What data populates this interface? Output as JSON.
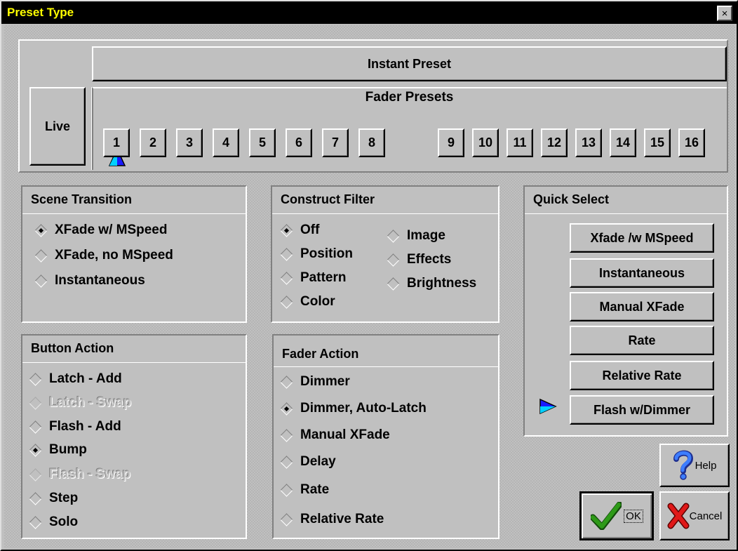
{
  "window": {
    "title": "Preset Type",
    "close": "×"
  },
  "top": {
    "instant_preset": "Instant Preset",
    "live": "Live",
    "fader_presets_label": "Fader Presets",
    "presets": [
      "1",
      "2",
      "3",
      "4",
      "5",
      "6",
      "7",
      "8",
      "9",
      "10",
      "11",
      "12",
      "13",
      "14",
      "15",
      "16"
    ],
    "selected_preset": "1"
  },
  "scene_transition": {
    "title": "Scene Transition",
    "options": [
      {
        "label": "XFade w/ MSpeed",
        "selected": true
      },
      {
        "label": "XFade, no MSpeed",
        "selected": false
      },
      {
        "label": "Instantaneous",
        "selected": false
      }
    ]
  },
  "construct_filter": {
    "title": "Construct Filter",
    "options": [
      {
        "label": "Off",
        "selected": true
      },
      {
        "label": "Position",
        "selected": false
      },
      {
        "label": "Pattern",
        "selected": false
      },
      {
        "label": "Color",
        "selected": false
      },
      {
        "label": "Image",
        "selected": false
      },
      {
        "label": "Effects",
        "selected": false
      },
      {
        "label": "Brightness",
        "selected": false
      }
    ]
  },
  "button_action": {
    "title": "Button Action",
    "options": [
      {
        "label": "Latch - Add",
        "selected": false,
        "disabled": false
      },
      {
        "label": "Latch - Swap",
        "selected": false,
        "disabled": true
      },
      {
        "label": "Flash - Add",
        "selected": false,
        "disabled": false
      },
      {
        "label": "Bump",
        "selected": true,
        "disabled": false
      },
      {
        "label": "Flash - Swap",
        "selected": false,
        "disabled": true
      },
      {
        "label": "Step",
        "selected": false,
        "disabled": false
      },
      {
        "label": "Solo",
        "selected": false,
        "disabled": false
      }
    ]
  },
  "fader_action": {
    "title": "Fader Action",
    "options": [
      {
        "label": "Dimmer",
        "selected": false
      },
      {
        "label": "Dimmer, Auto-Latch",
        "selected": true
      },
      {
        "label": "Manual XFade",
        "selected": false
      },
      {
        "label": "Delay",
        "selected": false
      },
      {
        "label": "Rate",
        "selected": false
      },
      {
        "label": "Relative Rate",
        "selected": false
      }
    ]
  },
  "quick_select": {
    "title": "Quick Select",
    "buttons": [
      "Xfade /w MSpeed",
      "Instantaneous",
      "Manual XFade",
      "Rate",
      "Relative Rate",
      "Flash w/Dimmer"
    ],
    "current": "Flash w/Dimmer"
  },
  "footer": {
    "help": "Help",
    "ok": "OK",
    "cancel": "Cancel"
  },
  "colors": {
    "title_bg": "#000000",
    "title_text": "#ffff00",
    "face": "#c0c0c0",
    "pointer": "#1a1aff",
    "ok_check": "#2e9a18",
    "cancel_x": "#d01010",
    "help_q": "#3050ff"
  },
  "icons": {
    "close": "close-icon",
    "preset_pointer": "arrow-up-icon",
    "quick_pointer": "arrow-right-icon",
    "help": "question-mark-icon",
    "ok": "checkmark-icon",
    "cancel": "x-mark-icon"
  }
}
